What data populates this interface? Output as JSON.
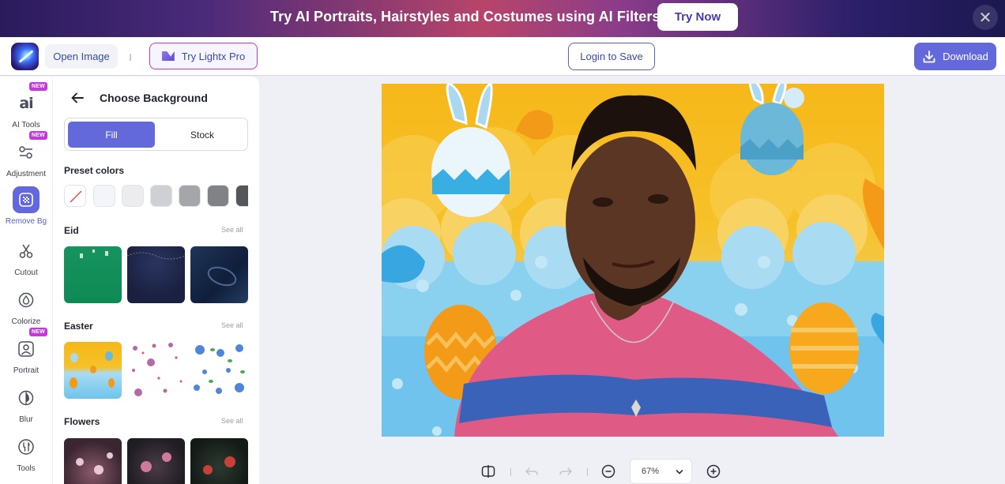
{
  "banner": {
    "text": "Try AI Portraits, Hairstyles and Costumes using AI Filters",
    "cta": "Try Now",
    "close_icon": "close-icon"
  },
  "toolbar": {
    "open_image": "Open Image",
    "try_pro": "Try Lightx Pro",
    "login": "Login to Save",
    "download": "Download"
  },
  "rail": {
    "items": [
      {
        "label": "AI Tools",
        "icon": "ai-icon",
        "badge": "NEW"
      },
      {
        "label": "Adjustment",
        "icon": "adjustment-icon",
        "badge": "NEW"
      },
      {
        "label": "Remove Bg",
        "icon": "remove-bg-icon",
        "active": true
      },
      {
        "label": "Cutout",
        "icon": "scissors-icon"
      },
      {
        "label": "Colorize",
        "icon": "drop-icon"
      },
      {
        "label": "Portrait",
        "icon": "portrait-icon",
        "badge": "NEW"
      },
      {
        "label": "Blur",
        "icon": "blur-icon"
      },
      {
        "label": "Tools",
        "icon": "tools-icon"
      }
    ]
  },
  "panel": {
    "title": "Choose Background",
    "tabs": {
      "fill": "Fill",
      "stock": "Stock"
    },
    "preset_label": "Preset colors",
    "preset_colors": [
      "none",
      "#f4f5fa",
      "#ececee",
      "#cfd0d3",
      "#a5a6a9",
      "#818285",
      "#55565a"
    ],
    "sections": [
      {
        "name": "Eid",
        "see_all": "See all"
      },
      {
        "name": "Easter",
        "see_all": "See all"
      },
      {
        "name": "Flowers",
        "see_all": "See all"
      }
    ]
  },
  "zoom": {
    "level": "67%"
  }
}
